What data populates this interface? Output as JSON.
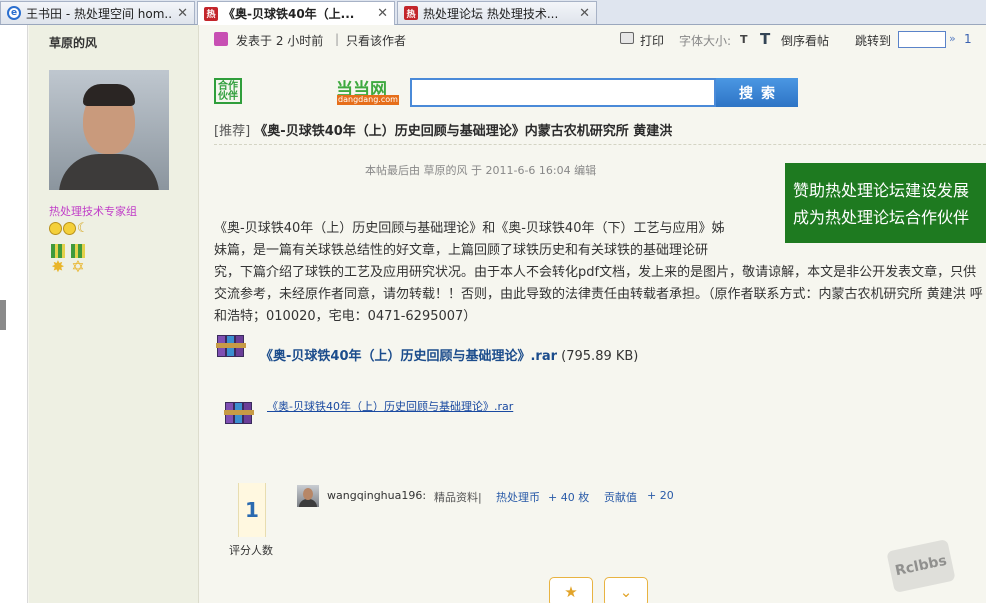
{
  "tabs": [
    {
      "title": "王书田 - 热处理空间 hom...",
      "icon": "ie-icon"
    },
    {
      "title": "《奥-贝球铁40年（上...",
      "icon": "site-icon"
    },
    {
      "title": "热处理论坛 热处理技术...",
      "icon": "site-icon"
    }
  ],
  "tab_close": "✕",
  "author": {
    "name": "草原的风",
    "group": "热处理技术专家组"
  },
  "postbar": {
    "posted": "发表于  2 小时前",
    "separator": "|",
    "only_author": "只看该作者",
    "print": "打印",
    "font_size": "字体大小:",
    "font_size_t": "T",
    "reverse_icon": "T",
    "reverse": "倒序看帖",
    "jump_to": "跳转到",
    "jump_go": "»",
    "page": "1"
  },
  "partner": {
    "hezuo": "合作伙伴",
    "dd_logo": "当当网",
    "dd_sub": "dangdang.com",
    "search_btn": "搜索"
  },
  "post": {
    "title_tag": "[推荐]",
    "title": "《奥-贝球铁40年（上）历史回顾与基础理论》内蒙古农机研究所  黄建洪",
    "edited": "本帖最后由  草原的风  于  2011-6-6 16:04 编辑",
    "ad_line1": "赞助热处理论坛建设发展",
    "ad_line2": "成为热处理论坛合作伙伴",
    "body_l1": "《奥-贝球铁40年（上）历史回顾与基础理论》和《奥-贝球铁40年（下）工艺与应用》姊",
    "body_l2": "妹篇，是一篇有关球铁总结性的好文章，上篇回顾了球铁历史和有关球铁的基础理论研",
    "body_l3": "究，下篇介绍了球铁的工艺及应用研究状况。由于本人不会转化pdf文档，发上来的是图片，敬请谅解，本文是非公开发表文章，只供交流参考，未经原作者同意，请勿转载！！否则，由此导致的法律责任由转载者承担。（原作者联系方式：内蒙古农机研究所  黄建洪  呼和浩特；010020，宅电：0471-6295007）",
    "attachment_name": "《奥-贝球铁40年（上）历史回顾与基础理论》.rar",
    "attachment_size": "(795.89 KB)",
    "attachment_link": "《奥-贝球铁40年（上）历史回顾与基础理论》.rar"
  },
  "rating": {
    "count": "1",
    "label": "评分人数",
    "rater": "wangqinghua196:",
    "category": "精品资料|",
    "item1": "热处理币",
    "item1_val": "+ 40 枚",
    "item2": "贡献值",
    "item2_val": "+ 20"
  },
  "actions": {
    "favorite_icon": "★",
    "share_icon": "⌄"
  },
  "watermark": "Rclbbs",
  "colors": {
    "ad_bg": "#1e7a20",
    "search_btn": "#2e74c5",
    "group_text": "#c03ec8"
  }
}
